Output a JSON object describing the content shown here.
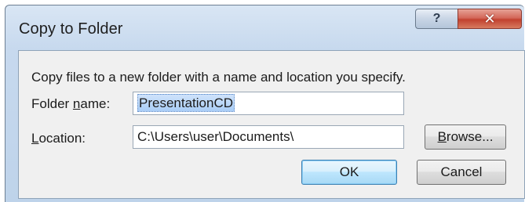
{
  "dialog": {
    "title": "Copy to Folder",
    "help_glyph": "?",
    "close_glyph": "✕",
    "description": "Copy files to a new folder with a name and location you specify.",
    "folder_name": {
      "label_pre": "Folder ",
      "label_accel": "n",
      "label_post": "ame:",
      "value": "PresentationCD"
    },
    "location": {
      "label_pre": "",
      "label_accel": "L",
      "label_post": "ocation:",
      "value": "C:\\Users\\user\\Documents\\"
    },
    "browse_button": {
      "label_pre": "",
      "label_accel": "B",
      "label_post": "rowse..."
    },
    "ok_label": "OK",
    "cancel_label": "Cancel"
  }
}
